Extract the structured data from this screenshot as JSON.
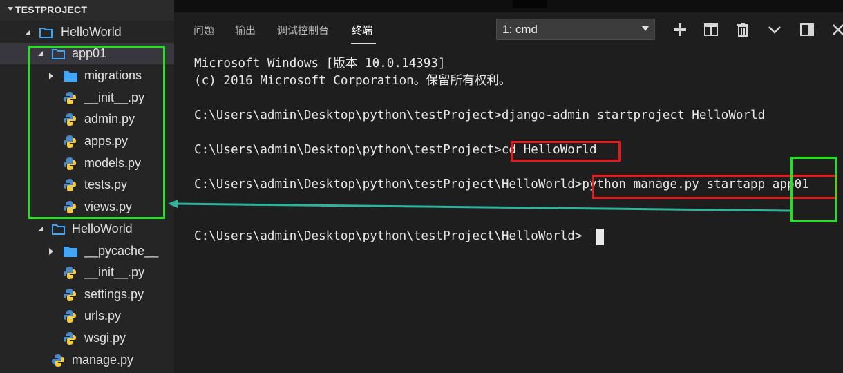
{
  "sidebar": {
    "section_title": "TESTPROJECT",
    "items": [
      {
        "label": "HelloWorld",
        "type": "folder",
        "expanded": true
      },
      {
        "label": "app01",
        "type": "folder",
        "expanded": true
      },
      {
        "label": "migrations",
        "type": "folder",
        "expanded": false
      },
      {
        "label": "__init__.py",
        "type": "python"
      },
      {
        "label": "admin.py",
        "type": "python"
      },
      {
        "label": "apps.py",
        "type": "python"
      },
      {
        "label": "models.py",
        "type": "python"
      },
      {
        "label": "tests.py",
        "type": "python"
      },
      {
        "label": "views.py",
        "type": "python"
      },
      {
        "label": "HelloWorld",
        "type": "folder",
        "expanded": true
      },
      {
        "label": "__pycache__",
        "type": "folder",
        "expanded": false
      },
      {
        "label": "__init__.py",
        "type": "python"
      },
      {
        "label": "settings.py",
        "type": "python"
      },
      {
        "label": "urls.py",
        "type": "python"
      },
      {
        "label": "wsgi.py",
        "type": "python"
      },
      {
        "label": "manage.py",
        "type": "python"
      }
    ]
  },
  "panel": {
    "tabs": [
      {
        "label": "问题",
        "active": false
      },
      {
        "label": "输出",
        "active": false
      },
      {
        "label": "调试控制台",
        "active": false
      },
      {
        "label": "终端",
        "active": true
      }
    ],
    "terminal_select": "1: cmd",
    "toolbar_icons": [
      "plus-icon",
      "split-icon",
      "trash-icon",
      "chevron-down-icon",
      "maximize-icon",
      "close-icon"
    ]
  },
  "terminal": {
    "lines": [
      "Microsoft Windows [版本 10.0.14393]",
      "(c) 2016 Microsoft Corporation。保留所有权利。",
      "C:\\Users\\admin\\Desktop\\python\\testProject>django-admin startproject HelloWorld",
      "C:\\Users\\admin\\Desktop\\python\\testProject>cd HelloWorld",
      "C:\\Users\\admin\\Desktop\\python\\testProject\\HelloWorld>python manage.py startapp app01",
      "C:\\Users\\admin\\Desktop\\python\\testProject\\HelloWorld>"
    ]
  },
  "colors": {
    "sidebar_bg": "#252526",
    "terminal_bg": "#1e1e1e",
    "folder_icon": "#42a5f5",
    "annotation_red": "#e51a1a",
    "annotation_green": "#22e022",
    "arrow_teal": "#2fb39a"
  }
}
